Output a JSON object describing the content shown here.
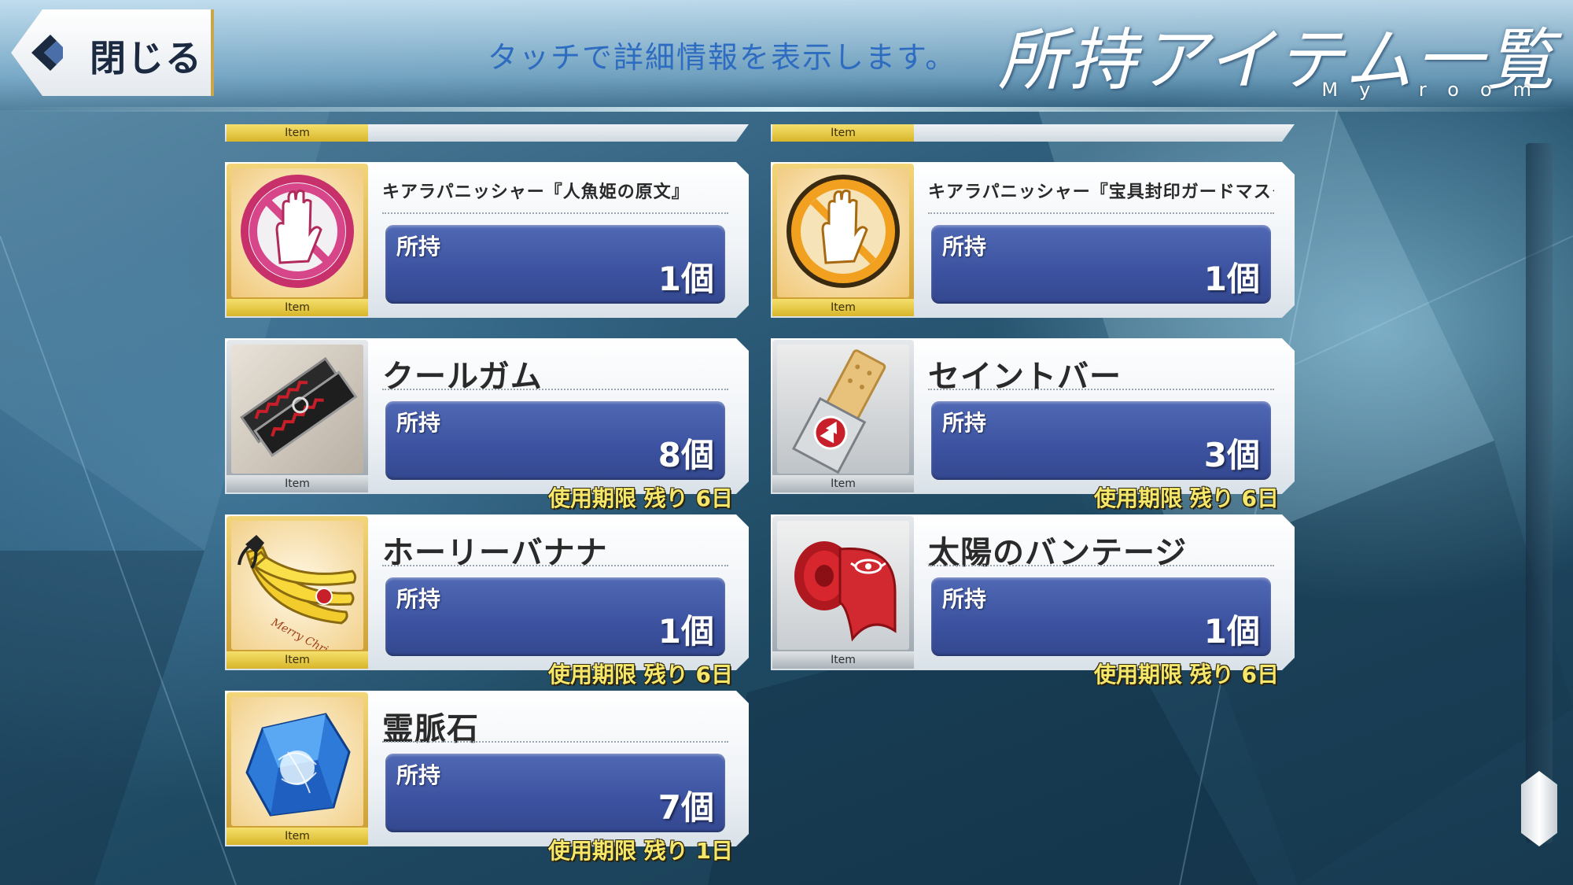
{
  "header": {
    "close_label": "閉じる",
    "hint": "タッチで詳細情報を表示します。",
    "title": "所持アイテム一覧",
    "subtitle": "My room"
  },
  "item_tag": "Item",
  "owned_label": "所持",
  "items": [
    {
      "name": "キアラパニッシャー『人魚姫の原文』",
      "count": "1個",
      "expiry": "",
      "icon": "pink-stop-hand-icon"
    },
    {
      "name": "キアラパニッシャー『宝具封印ガードマスク』",
      "count": "1個",
      "expiry": "",
      "icon": "orange-stop-hand-icon"
    },
    {
      "name": "クールガム",
      "count": "8個",
      "expiry": "使用期限 残り 6日",
      "icon": "cool-gum-icon"
    },
    {
      "name": "セイントバー",
      "count": "3個",
      "expiry": "使用期限 残り 6日",
      "icon": "saint-bar-icon"
    },
    {
      "name": "ホーリーバナナ",
      "count": "1個",
      "expiry": "使用期限 残り 6日",
      "icon": "holy-banana-icon"
    },
    {
      "name": "太陽のバンテージ",
      "count": "1個",
      "expiry": "使用期限 残り 6日",
      "icon": "sun-bandage-icon"
    },
    {
      "name": "霊脈石",
      "count": "7個",
      "expiry": "使用期限 残り 1日",
      "icon": "spirit-stone-icon"
    }
  ],
  "icon_art": {
    "0": "Merry Christmas"
  },
  "colors": {
    "owned_panel": "#3c52a0",
    "expiry_text": "#f4e76a",
    "gold_frame": "#d8b52a",
    "hint_text": "#2d6cc0"
  }
}
